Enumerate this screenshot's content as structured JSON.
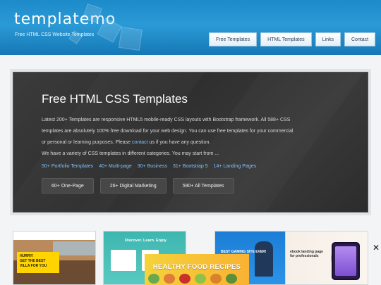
{
  "header": {
    "logo_part1": "template",
    "logo_part2": "mo",
    "tagline": "Free HTML CSS Website Templates",
    "nav": [
      "Free Templates",
      "HTML Templates",
      "Links",
      "Contact"
    ]
  },
  "hero": {
    "title": "Free HTML CSS Templates",
    "para_start": "Latest 200+ Templates are responsive HTML5 mobile-ready CSS layouts with Bootstrap framework. All 588+ CSS templates are absolutely 100% free download for your web design. You can use free templates for your commercial or personal or learning purposes. Please ",
    "para_link": "contact",
    "para_end": " us if you have any question.",
    "variety": "We have a variety of CSS templates in different categories. You may start from ...",
    "categories": [
      "50+ Portfolio Templates",
      "40+ Multi-page",
      "30+ Business",
      "31+ Bootstrap 5",
      "14+ Landing Pages"
    ],
    "buttons": [
      "60+ One-Page",
      "26+ Digital Marketing",
      "590+ All Templates"
    ]
  },
  "thumbnails": {
    "t1_text": "HURRY!\nGET THE BEST\nVILLA FOR YOU",
    "t2_text": "Discover. Learn. Enjoy",
    "t3_text": "BEST GAMING SITE EVER!",
    "t4_text": "ebook landing page\nfor professionals"
  },
  "ad": {
    "left_text": "HURRY!\nGET THE BEST\nVILLA FOR YOU",
    "title": "HEALTHY FOOD RECIPES",
    "close": "✕"
  }
}
